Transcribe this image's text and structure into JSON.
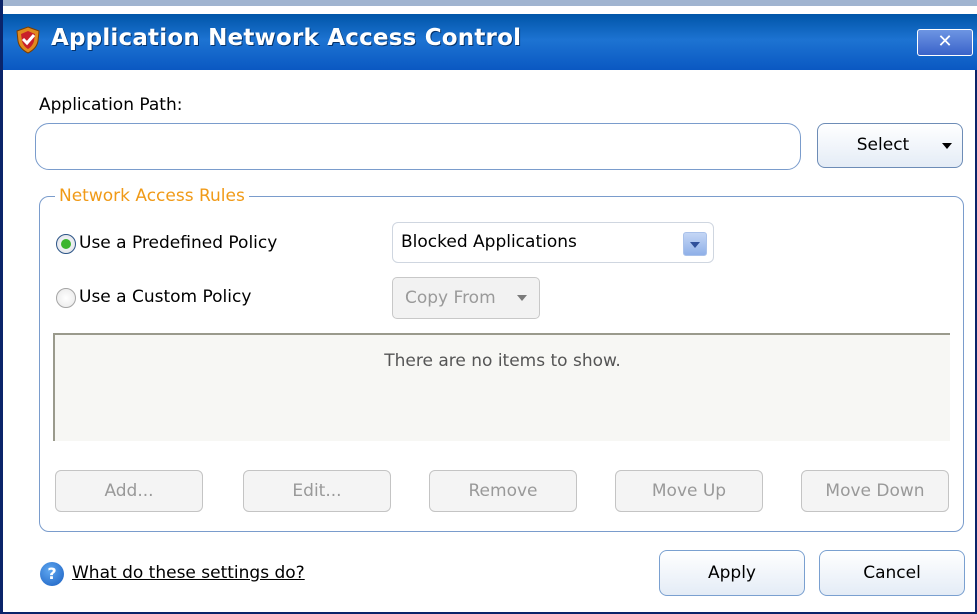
{
  "window": {
    "title": "Application Network Access Control",
    "close_label": "✕"
  },
  "app_path": {
    "label": "Application Path:",
    "value": "",
    "select_button_label": "Select"
  },
  "rules": {
    "group_title": "Network Access Rules",
    "predefined_label": "Use a Predefined Policy",
    "predefined_selected": true,
    "predefined_value": "Blocked Applications",
    "custom_label": "Use a Custom Policy",
    "custom_selected": false,
    "copy_from_label": "Copy From",
    "empty_message": "There are no items to show.",
    "buttons": {
      "add": "Add...",
      "edit": "Edit...",
      "remove": "Remove",
      "move_up": "Move Up",
      "move_down": "Move Down"
    }
  },
  "footer": {
    "help_link": "What do these settings do?",
    "help_icon": "question-icon",
    "apply": "Apply",
    "cancel": "Cancel"
  },
  "colors": {
    "title_bar": "#0a58c2",
    "group_title": "#f09a17",
    "radio_selected": "#3cb52e"
  }
}
